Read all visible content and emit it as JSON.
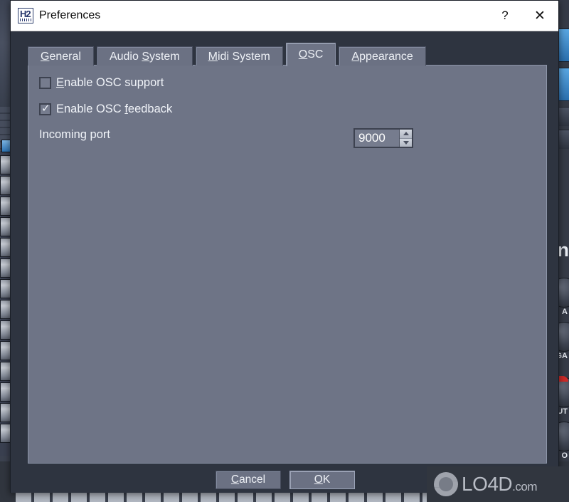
{
  "window": {
    "title": "Preferences",
    "icon": "hydrogen-h2-icon",
    "icon_text": "H2",
    "help_label": "?",
    "close_label": "✕"
  },
  "tabs": [
    {
      "id": "general",
      "label": "General",
      "mnemonic": "G",
      "selected": false
    },
    {
      "id": "audio-system",
      "label": "Audio System",
      "mnemonic": "S",
      "selected": false
    },
    {
      "id": "midi-system",
      "label": "Midi System",
      "mnemonic": "M",
      "selected": false
    },
    {
      "id": "osc",
      "label": "OSC",
      "mnemonic": "O",
      "selected": true
    },
    {
      "id": "appearance",
      "label": "Appearance",
      "mnemonic": "A",
      "selected": false
    }
  ],
  "osc_panel": {
    "enable_support": {
      "label": "Enable OSC support",
      "mnemonic": "E",
      "checked": false,
      "tick": "✓"
    },
    "enable_feedback": {
      "label": "Enable OSC feedback",
      "mnemonic": "f",
      "checked": true,
      "tick": "✓"
    },
    "incoming_port": {
      "label": "Incoming port",
      "value": "9000",
      "spin_up": "increment",
      "spin_down": "decrement"
    }
  },
  "buttons": {
    "cancel": {
      "label": "Cancel",
      "mnemonic": "C"
    },
    "ok": {
      "label": "OK",
      "mnemonic": "O",
      "default": true
    }
  },
  "watermark": {
    "text": "LO4D",
    "domain": ".com"
  },
  "colors": {
    "dialog_bg": "#2e3440",
    "panel_bg": "#6e7486",
    "tab_bg": "#6b7183",
    "titlebar_bg": "#ffffff",
    "text": "#f0f3f8",
    "border_dark": "#3d4250",
    "app_backdrop": "#2f3440"
  }
}
